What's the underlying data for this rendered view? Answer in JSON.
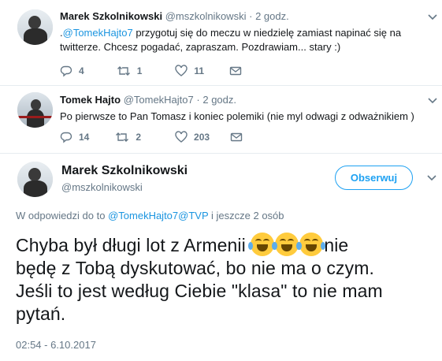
{
  "tweet1": {
    "name": "Marek Szkolnikowski",
    "handle": "@mszkolnikowski",
    "dot": "·",
    "time": "2 godz.",
    "text_prefix": ".",
    "mention": "@TomekHajto7",
    "text_line1_rest": " przygotuj się do meczu w niedzielę zamiast napinać się na",
    "text_line2": "twitterze. Chcesz pogadać, zapraszam. Pozdrawiam... stary :)",
    "replies": "4",
    "retweets": "1",
    "likes": "11"
  },
  "tweet2": {
    "name": "Tomek Hajto",
    "handle": "@TomekHajto7",
    "dot": "·",
    "time": "2 godz.",
    "text": "Po pierwsze to Pan Tomasz i koniec polemiki (nie myl odwagi z odważnikiem )",
    "replies": "14",
    "retweets": "2",
    "likes": "203"
  },
  "main": {
    "name": "Marek Szkolnikowski",
    "handle": "@mszkolnikowski",
    "follow_label": "Obserwuj",
    "reply_prefix": "W odpowiedzi do to ",
    "reply_mention1": "@TomekHajto7",
    "reply_mention2": "@TVP",
    "reply_suffix": " i jeszcze 2 osób",
    "line1_before": "Chyba był długi lot z Armenii ",
    "line1_after": "nie",
    "line2": "będę z Tobą dyskutować, bo nie ma o czym.",
    "line3": "Jeśli to jest według Ciebie \"klasa\" to nie mam",
    "line4": "pytań.",
    "timestamp": "02:54 - 6.10.2017"
  },
  "icons": {
    "reply": "reply-icon",
    "retweet": "retweet-icon",
    "like": "heart-icon",
    "dm": "envelope-icon",
    "chevron": "chevron-down-icon",
    "emoji": "face-with-tears-of-joy-icon"
  },
  "colors": {
    "link": "#1b95e0",
    "follow": "#1da1f2",
    "secondary": "#657786"
  }
}
